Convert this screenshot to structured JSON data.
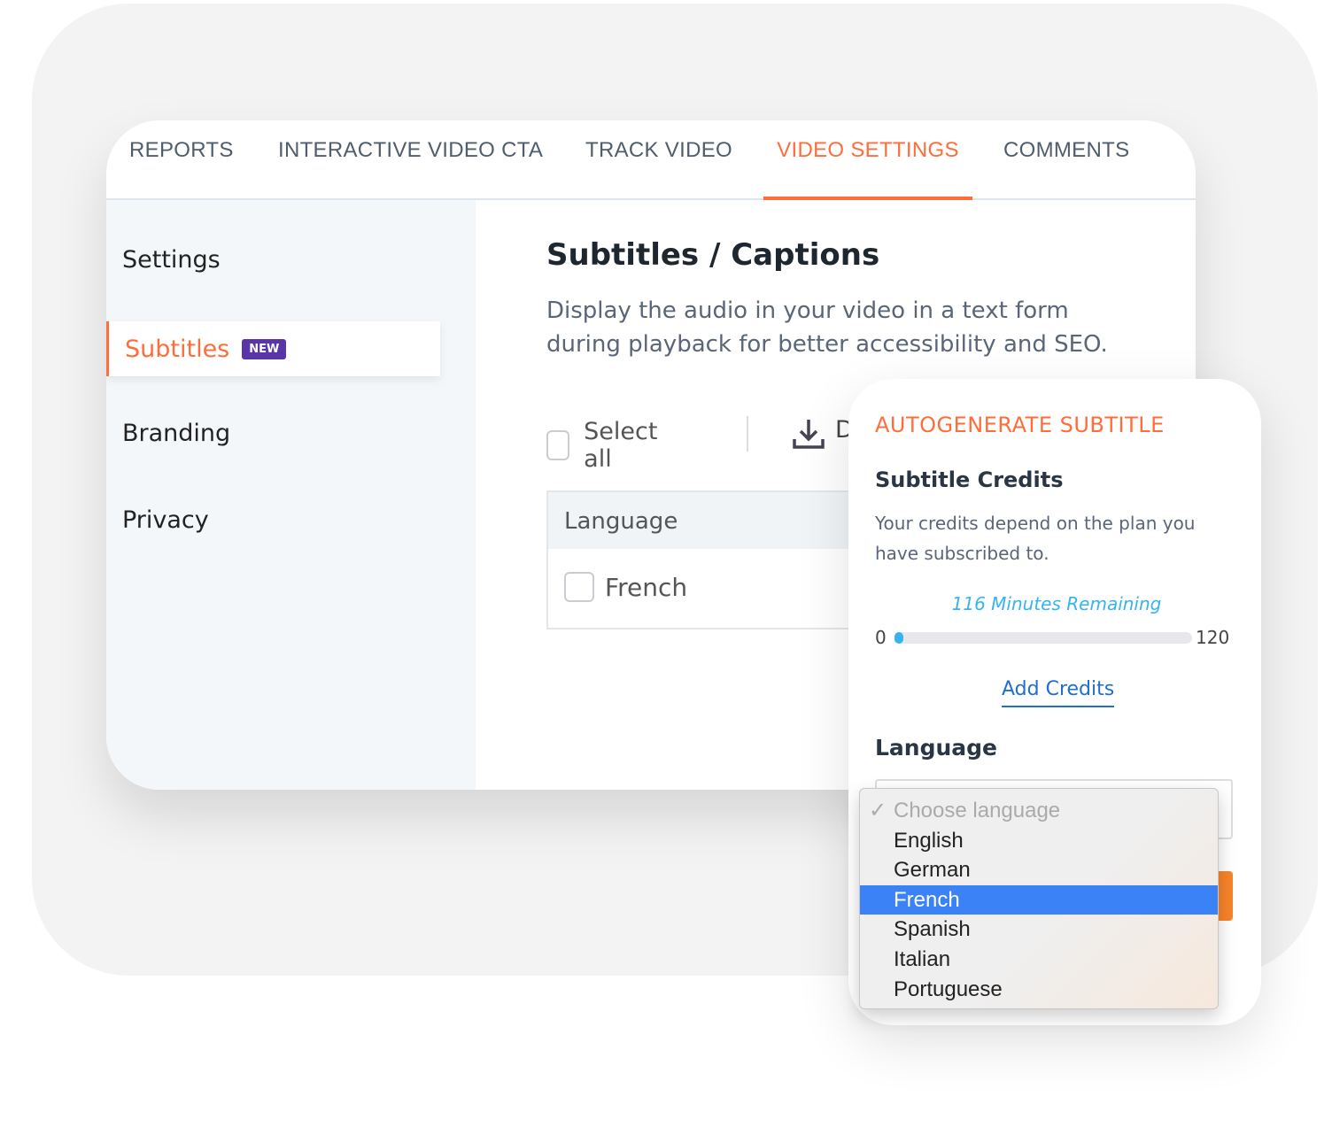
{
  "tabs": [
    {
      "label": "REPORTS"
    },
    {
      "label": "INTERACTIVE VIDEO CTA"
    },
    {
      "label": "TRACK VIDEO"
    },
    {
      "label": "VIDEO SETTINGS",
      "active": true
    },
    {
      "label": "COMMENTS"
    }
  ],
  "sidebar": {
    "items": [
      {
        "label": "Settings"
      },
      {
        "label": "Subtitles",
        "badge": "NEW",
        "active": true
      },
      {
        "label": "Branding"
      },
      {
        "label": "Privacy"
      }
    ]
  },
  "main": {
    "title": "Subtitles / Captions",
    "description": "Display the audio in your video in a text form during playback for better accessibility and SEO.",
    "select_all": "Select all",
    "download_partial": "D",
    "table": {
      "header": "Language",
      "rows": [
        {
          "language": "French",
          "checked": false
        }
      ]
    }
  },
  "panel": {
    "title": "AUTOGENERATE SUBTITLE",
    "credits_heading": "Subtitle Credits",
    "credits_text": "Your credits depend on the plan you have subscribed to.",
    "remaining": "116 Minutes Remaining",
    "range_min": "0",
    "range_max": "120",
    "progress_fill_fraction": 0.03,
    "add_credits": "Add Credits",
    "language_label": "Language"
  },
  "dropdown": {
    "placeholder": "Choose language",
    "options": [
      "English",
      "German",
      "French",
      "Spanish",
      "Italian",
      "Portuguese"
    ],
    "selected": "French"
  },
  "colors": {
    "accent": "#ff6d3a",
    "badge": "#5a35a8",
    "link": "#1e6fd0",
    "progress": "#37b3ef",
    "selected_option": "#3b82f6"
  }
}
